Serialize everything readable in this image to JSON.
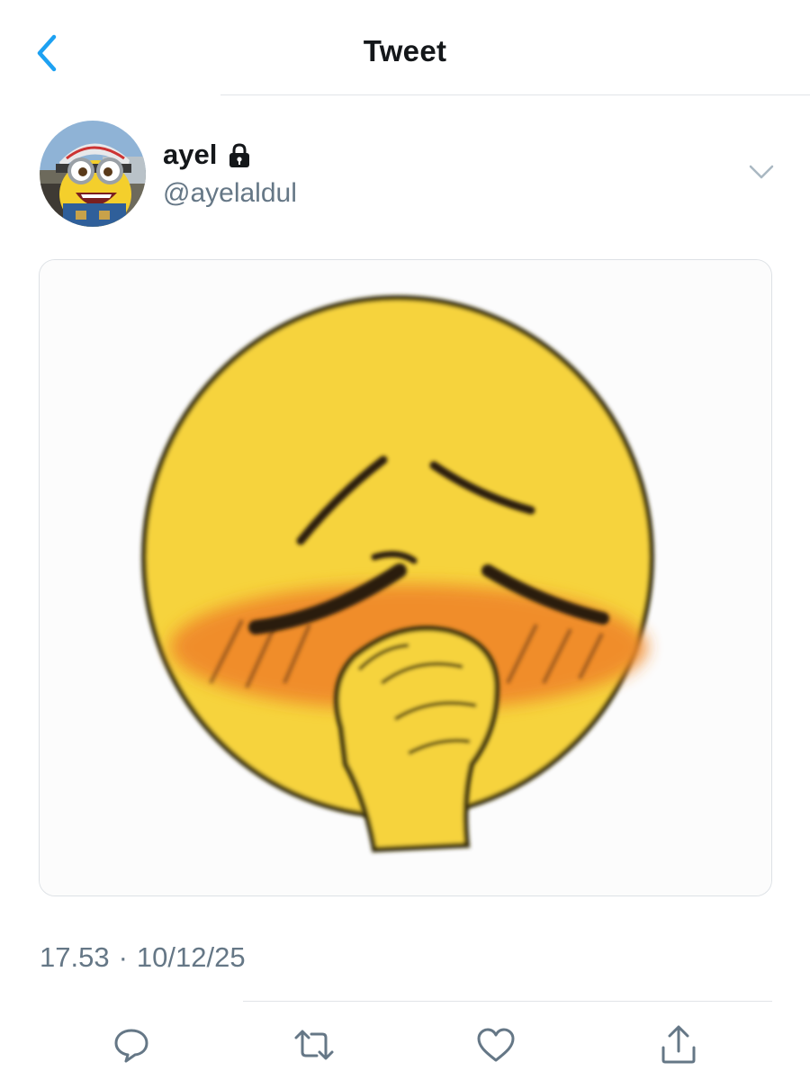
{
  "header": {
    "title": "Tweet",
    "back_icon": "chevron-left-icon",
    "accent_color": "#1da1f2"
  },
  "author": {
    "display_name": "ayel",
    "handle": "@ayelaldul",
    "protected": true,
    "lock_icon": "lock-icon",
    "menu_icon": "chevron-down-icon",
    "avatar_desc": "minion-avatar"
  },
  "tweet": {
    "media_icon": "blushing-emoji-image",
    "time": "17.53",
    "separator": "·",
    "date": "10/12/25"
  },
  "actions": {
    "reply_icon": "reply-icon",
    "retweet_icon": "retweet-icon",
    "like_icon": "like-icon",
    "share_icon": "share-icon",
    "icon_color": "#657786"
  }
}
